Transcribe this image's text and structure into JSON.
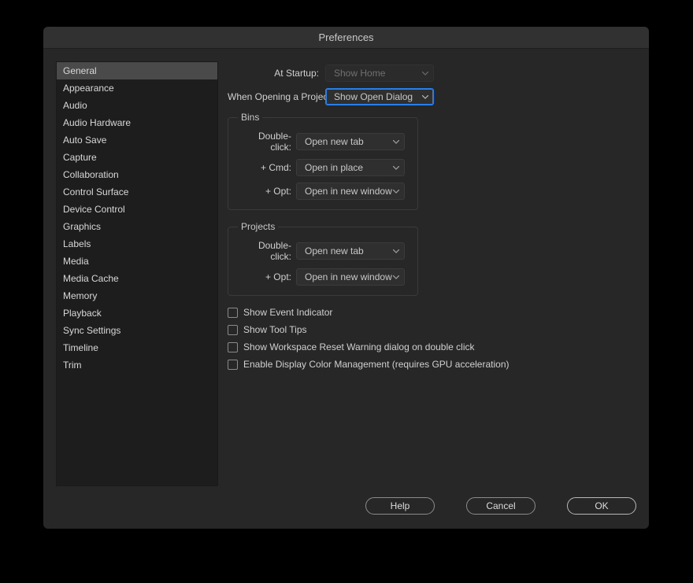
{
  "title": "Preferences",
  "sidebar": {
    "items": [
      "General",
      "Appearance",
      "Audio",
      "Audio Hardware",
      "Auto Save",
      "Capture",
      "Collaboration",
      "Control Surface",
      "Device Control",
      "Graphics",
      "Labels",
      "Media",
      "Media Cache",
      "Memory",
      "Playback",
      "Sync Settings",
      "Timeline",
      "Trim"
    ],
    "selected": "General"
  },
  "main": {
    "startup": {
      "label": "At Startup:",
      "value": "Show Home"
    },
    "open_project": {
      "label": "When Opening a Project:",
      "value": "Show Open Dialog"
    },
    "bins": {
      "legend": "Bins",
      "rows": {
        "dblclick": {
          "label": "Double-click:",
          "value": "Open new tab"
        },
        "cmd": {
          "label": "+ Cmd:",
          "value": "Open in place"
        },
        "opt": {
          "label": "+ Opt:",
          "value": "Open in new window"
        }
      }
    },
    "projects": {
      "legend": "Projects",
      "rows": {
        "dblclick": {
          "label": "Double-click:",
          "value": "Open new tab"
        },
        "opt": {
          "label": "+ Opt:",
          "value": "Open in new window"
        }
      }
    },
    "checkboxes": {
      "eventIndicator": "Show Event Indicator",
      "toolTips": "Show Tool Tips",
      "workspaceReset": "Show Workspace Reset Warning dialog on double click",
      "colorMgmt": "Enable Display Color Management (requires GPU acceleration)"
    }
  },
  "footer": {
    "help": "Help",
    "cancel": "Cancel",
    "ok": "OK"
  }
}
